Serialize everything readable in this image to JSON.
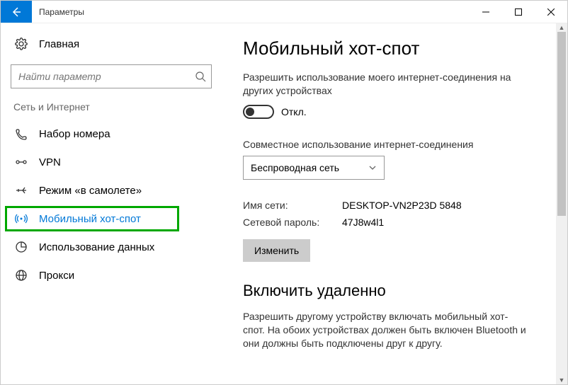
{
  "window": {
    "title": "Параметры"
  },
  "sidebar": {
    "home": "Главная",
    "search_placeholder": "Найти параметр",
    "section": "Сеть и Интернет",
    "items": [
      {
        "label": "Набор номера"
      },
      {
        "label": "VPN"
      },
      {
        "label": "Режим «в самолете»"
      },
      {
        "label": "Мобильный хот-спот"
      },
      {
        "label": "Использование данных"
      },
      {
        "label": "Прокси"
      }
    ]
  },
  "main": {
    "heading": "Мобильный хот-спот",
    "share_desc": "Разрешить использование моего интернет-соединения на других устройствах",
    "toggle_state": "Откл.",
    "share_from_label": "Совместное использование интернет-соединения",
    "share_from_value": "Беспроводная сеть",
    "net_name_label": "Имя сети:",
    "net_name_value": "DESKTOP-VN2P23D 5848",
    "net_pass_label": "Сетевой пароль:",
    "net_pass_value": "47J8w4l1",
    "change_btn": "Изменить",
    "remote_heading": "Включить удаленно",
    "remote_desc": "Разрешить другому устройству включать мобильный хот-спот. На обоих устройствах должен быть включен Bluetooth и они должны быть подключены друг к другу."
  }
}
